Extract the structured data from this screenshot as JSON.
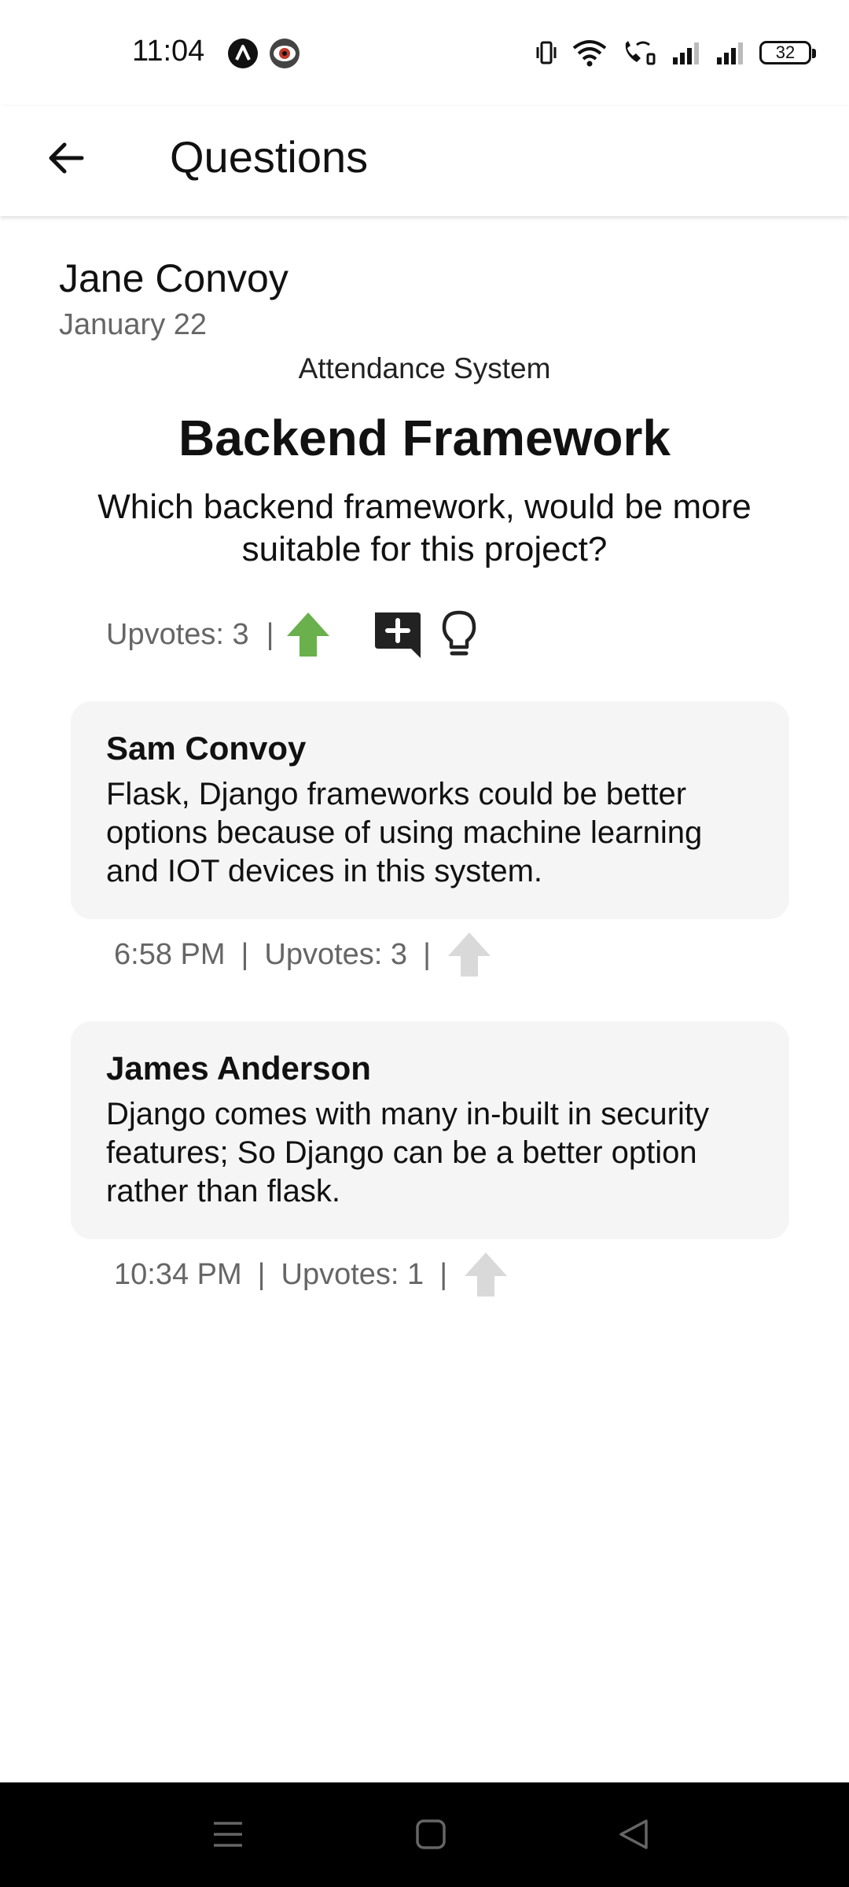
{
  "status_bar": {
    "time": "11:04",
    "battery": "32",
    "icons": [
      "app-a-icon",
      "eye-app-icon",
      "vibrate-icon",
      "wifi-icon",
      "wifi-calling-icon",
      "signal-1-icon",
      "signal-2-icon",
      "battery-icon"
    ]
  },
  "app_bar": {
    "title": "Questions",
    "back_icon": "arrow-left-icon"
  },
  "question": {
    "author": "Jane Convoy",
    "date": "January 22",
    "project": "Attendance System",
    "title": "Backend Framework",
    "body": "Which backend framework, would be more suitable for this project?",
    "upvotes_label": "Upvotes: 3",
    "separator": "|",
    "upvoted": true,
    "actions": [
      "upvote-icon",
      "add-comment-icon",
      "lightbulb-icon"
    ]
  },
  "answers": [
    {
      "author": "Sam Convoy",
      "text": "Flask, Django frameworks could be better options because of using machine learning and IOT devices in this system.",
      "time": "6:58 PM",
      "upvotes_label": "Upvotes: 3",
      "upvoted": false
    },
    {
      "author": "James Anderson",
      "text": "Django comes with many in-built in security features; So Django can be a better option rather than flask.",
      "time": "10:34 PM",
      "upvotes_label": "Upvotes: 1",
      "upvoted": false
    }
  ],
  "colors": {
    "upvote_active": "#6ab04c",
    "upvote_inactive": "#d9d9d9",
    "card_bg": "#f5f5f5",
    "nav_bar": "#000000"
  },
  "nav_bar": {
    "buttons": [
      "menu-icon",
      "home-icon",
      "back-triangle-icon"
    ]
  }
}
